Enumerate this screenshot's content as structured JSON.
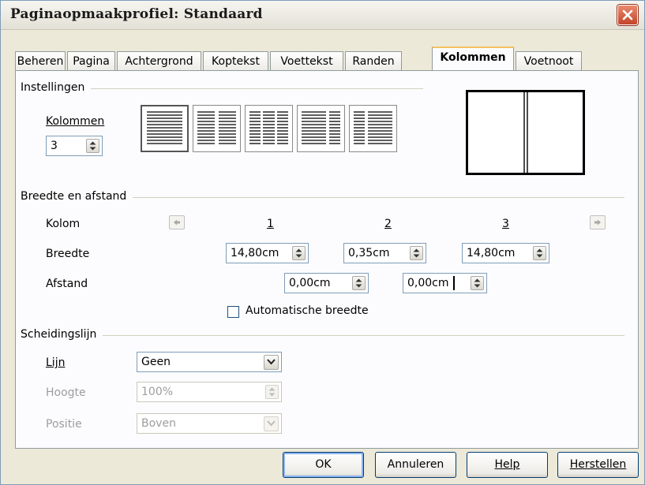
{
  "window": {
    "title": "Paginaopmaakprofiel: Standaard"
  },
  "tabs": [
    {
      "label": "Beheren"
    },
    {
      "label": "Pagina"
    },
    {
      "label": "Achtergrond"
    },
    {
      "label": "Koptekst"
    },
    {
      "label": "Voettekst"
    },
    {
      "label": "Randen"
    },
    {
      "label": "Kolommen",
      "active": true
    },
    {
      "label": "Voetnoot"
    }
  ],
  "instellingen": {
    "title": "Instellingen",
    "kolommen_label": "Kolommen",
    "kolommen_value": "3",
    "layouts": [
      "layout-1",
      "layout-2",
      "layout-3",
      "layout-4",
      "layout-5"
    ],
    "selected_layout": 1
  },
  "breedte": {
    "title": "Breedte en afstand",
    "kolom_label": "Kolom",
    "col_numbers": [
      "1",
      "2",
      "3"
    ],
    "breedte_label": "Breedte",
    "breedte_values": [
      "14,80cm",
      "0,35cm",
      "14,80cm"
    ],
    "afstand_label": "Afstand",
    "afstand_values": [
      "0,00cm",
      "0,00cm"
    ],
    "auto_label": "Automatische breedte",
    "auto_checked": false
  },
  "scheiding": {
    "title": "Scheidingslijn",
    "lijn_label": "Lijn",
    "lijn_value": "Geen",
    "hoogte_label": "Hoogte",
    "hoogte_value": "100%",
    "positie_label": "Positie",
    "positie_value": "Boven"
  },
  "buttons": {
    "ok": "OK",
    "annuleren": "Annuleren",
    "help": "Help",
    "herstellen": "Herstellen"
  },
  "colors": {
    "accent_tab": "#f6c25f",
    "close": "#c3452a"
  }
}
